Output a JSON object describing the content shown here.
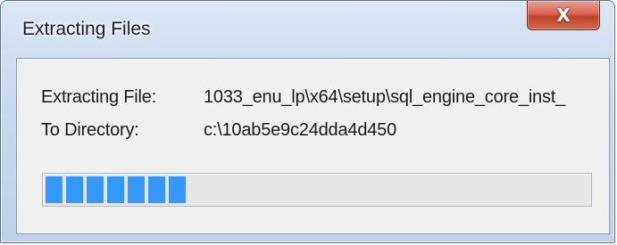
{
  "window": {
    "title": "Extracting Files"
  },
  "titlebar": {
    "close_label": "X"
  },
  "content": {
    "extracting_label": "Extracting File:",
    "extracting_value": "1033_enu_lp\\x64\\setup\\sql_engine_core_inst_",
    "directory_label": "To Directory:",
    "directory_value": "c:\\10ab5e9c24dda4d450"
  },
  "progress": {
    "fraction": 0.26,
    "filled_blocks": 7,
    "color": "#3399ff"
  }
}
